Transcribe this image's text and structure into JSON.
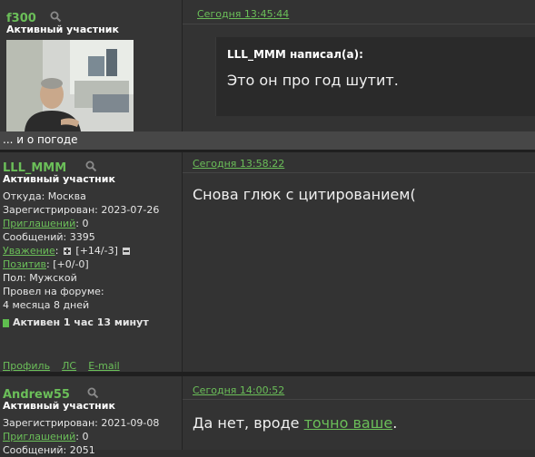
{
  "posts": [
    {
      "username": "f300",
      "rank": "Активный участник",
      "date": "Сегодня 13:45:44",
      "quote_author": "LLL_MMM написал(а):",
      "quote_text": "Это он про год шутит.",
      "signature": "... и о погоде"
    },
    {
      "username": "LLL_MMM",
      "rank": "Активный участник",
      "from": "Откуда: Москва",
      "registered": "Зарегистрирован: 2023-07-26",
      "invites_label": "Приглашений",
      "invites_value": ": 0",
      "messages": "Сообщений: 3395",
      "respect_label": "Уважение",
      "respect_value": "[+14/-3]",
      "positive_label": "Позитив",
      "positive_value": ": [+0/-0]",
      "gender": "Пол: Мужской",
      "time_on_forum_label": "Провел на форуме:",
      "time_on_forum_value": "4 месяца 8 дней",
      "active_status": "Активен 1 час 13 минут",
      "date": "Сегодня 13:58:22",
      "message": "Снова глюк с цитированием(",
      "footer": {
        "profile": "Профиль",
        "pm": "ЛС",
        "email": "E-mail"
      }
    },
    {
      "username": "Andrew55",
      "rank": "Активный участник",
      "registered": "Зарегистрирован: 2021-09-08",
      "invites_label": "Приглашений",
      "invites_value": ": 0",
      "messages_partial": "Сообщений: 2051",
      "date": "Сегодня 14:00:52",
      "message_prefix": "Да нет, вроде ",
      "message_link": "точно ваше",
      "message_suffix": "."
    }
  ],
  "icons": {
    "search": "search-icon",
    "plus": "plus-icon",
    "minus": "minus-icon",
    "status": "online-status-icon"
  },
  "colors": {
    "accent": "#6bbf59",
    "background": "#2f2f2f"
  }
}
